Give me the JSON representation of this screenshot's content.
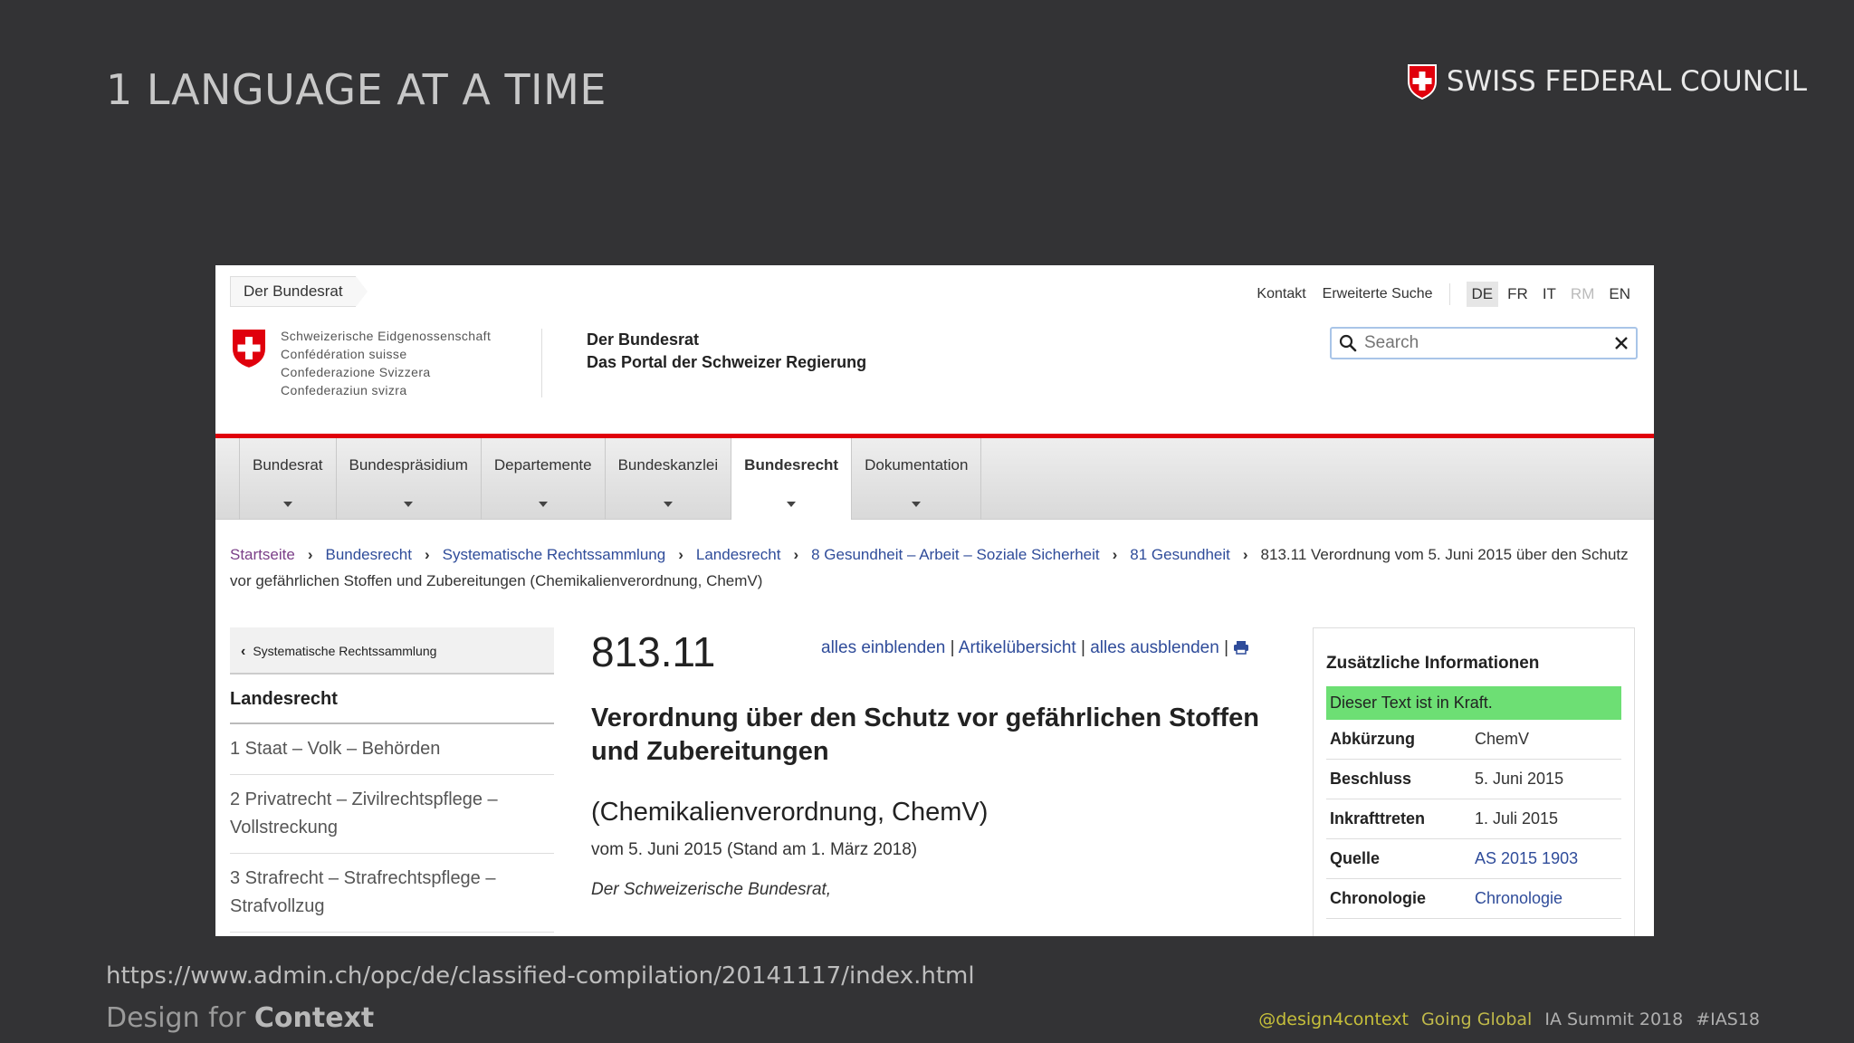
{
  "slide": {
    "title": "1 LANGUAGE AT A TIME",
    "brand": "SWISS FEDERAL COUNCIL",
    "url": "https://www.admin.ch/opc/de/classified-compilation/20141117/index.html",
    "footer_left_prefix": "Design for ",
    "footer_left_strong": "Context",
    "footer_tags": [
      "@design4context",
      "Going Global",
      "IA Summit 2018",
      "#IAS18"
    ]
  },
  "site": {
    "tab_label": "Der Bundesrat",
    "logo_lines": [
      "Schweizerische Eidgenossenschaft",
      "Confédération suisse",
      "Confederazione Svizzera",
      "Confederaziun svizra"
    ],
    "portal_title": "Der Bundesrat",
    "portal_subtitle": "Das Portal der Schweizer Regierung",
    "meta": {
      "kontakt": "Kontakt",
      "advanced": "Erweiterte Suche"
    },
    "languages": [
      "DE",
      "FR",
      "IT",
      "RM",
      "EN"
    ],
    "active_language": "DE",
    "search_placeholder": "Search",
    "nav": [
      "Bundesrat",
      "Bundespräsidium",
      "Departemente",
      "Bundeskanzlei",
      "Bundesrecht",
      "Dokumentation"
    ],
    "active_nav": "Bundesrecht",
    "breadcrumb": [
      "Startseite",
      "Bundesrecht",
      "Systematische Rechtssammlung",
      "Landesrecht",
      "8 Gesundheit – Arbeit – Soziale Sicherheit",
      "81 Gesundheit"
    ],
    "breadcrumb_current": "813.11 Verordnung vom 5. Juni 2015 über den Schutz vor gefährlichen Stoffen und Zubereitungen (Chemikalienverordnung, ChemV)",
    "leftnav": {
      "back": "Systematische Rechtssammlung",
      "heading": "Landesrecht",
      "items": [
        "1 Staat – Volk – Behörden",
        "2 Privatrecht – Zivilrechtspflege – Vollstreckung",
        "3 Strafrecht – Strafrechtspflege – Strafvollzug"
      ]
    },
    "main": {
      "number": "813.11",
      "toolbar": {
        "show_all": "alles einblenden",
        "overview": "Artikelübersicht",
        "hide_all": "alles ausblenden"
      },
      "title": "Verordnung über den Schutz vor gefährlichen Stoffen und Zubereitungen",
      "subtitle": "(Chemikalienverordnung, ChemV)",
      "date": "vom 5. Juni 2015 (Stand am 1. März 2018)",
      "preamble": "Der Schweizerische Bundesrat,"
    },
    "sidebox": {
      "title": "Zusätzliche Informationen",
      "status": "Dieser Text ist in Kraft.",
      "rows": [
        {
          "k": "Abkürzung",
          "v": "ChemV"
        },
        {
          "k": "Beschluss",
          "v": "5. Juni 2015"
        },
        {
          "k": "Inkrafttreten",
          "v": "1. Juli 2015"
        },
        {
          "k": "Quelle",
          "v": "AS 2015 1903"
        },
        {
          "k": "Chronologie",
          "v": "Chronologie"
        }
      ]
    }
  },
  "colors": {
    "swiss_red": "#e0000c",
    "status_green": "#6ddf74",
    "link_blue": "#2f4c9a"
  }
}
